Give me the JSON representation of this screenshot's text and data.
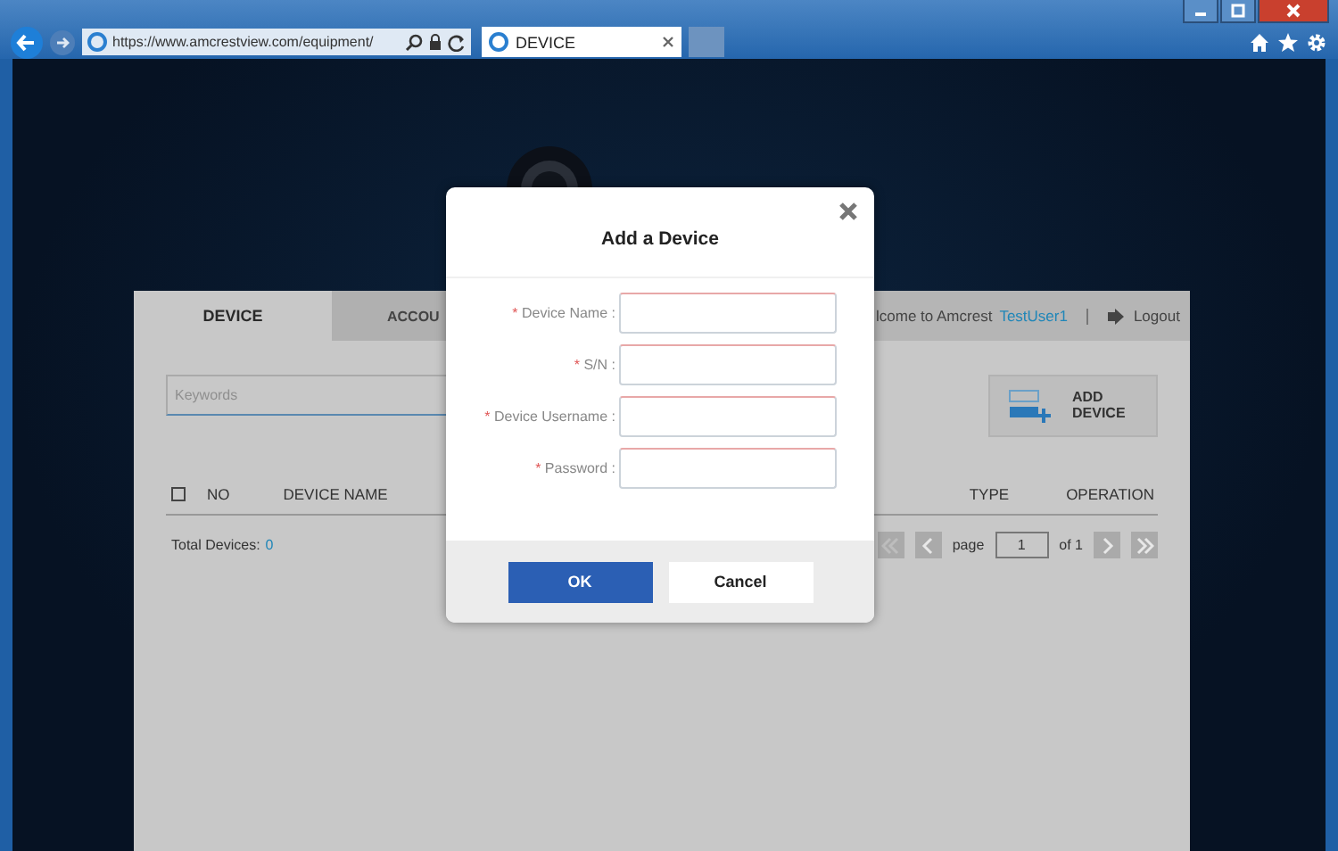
{
  "browser": {
    "address": "https://www.amcrestview.com/equipment/",
    "tab": "DEVICE"
  },
  "page": {
    "tabs": [
      {
        "label": "DEVICE",
        "selected": true
      },
      {
        "label": "ACCOU",
        "selected": false
      }
    ],
    "welcome": "lcome to Amcrest",
    "user": "TestUser1",
    "logout": "Logout",
    "search": {
      "placeholder": "Keywords"
    },
    "add_button": "ADD DEVICE",
    "table": {
      "select_all": {
        "checked": false
      },
      "columns": [
        "NO",
        "DEVICE NAME",
        "TYPE",
        "OPERATION"
      ]
    },
    "total_label": "Total Devices:",
    "total": "0",
    "pager": {
      "page_label": "page",
      "page": "1",
      "of": "of 1"
    }
  },
  "dialog": {
    "title": "Add a Device",
    "fields": [
      {
        "required": true,
        "mark": "*",
        "label": "Device Name :"
      },
      {
        "required": true,
        "mark": "*",
        "label": "S/N :"
      },
      {
        "required": true,
        "mark": "*",
        "label": "Device Username :"
      },
      {
        "required": true,
        "mark": "*",
        "label": "Password :"
      }
    ],
    "buttons": [
      {
        "label": "OK",
        "kind": "primary"
      },
      {
        "label": "Cancel",
        "kind": "secondary"
      }
    ]
  }
}
